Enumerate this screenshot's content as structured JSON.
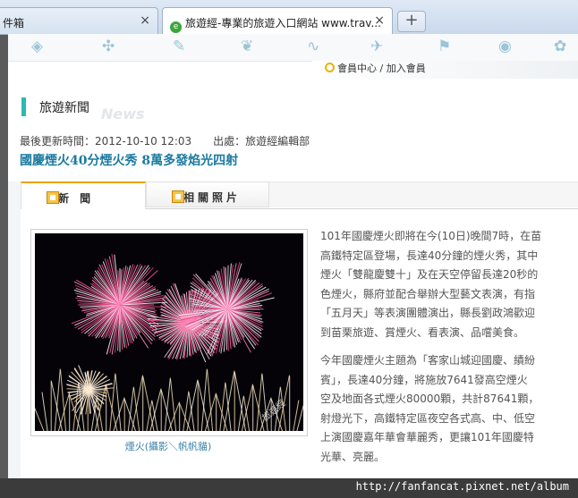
{
  "browser": {
    "tab1_title": "件箱",
    "tab2_title": "旅遊經-專業的旅遊入口網站 www.trav...",
    "close_glyph": "×",
    "newtab_glyph": "+"
  },
  "site": {
    "member_link": "會員中心 / 加入會員",
    "section_title": "旅遊新聞",
    "section_watermark": "News"
  },
  "article": {
    "meta_updated": "最後更新時間：2012-10-10 12:03",
    "meta_source": "出處：旅遊經編輯部",
    "headline": "國慶煙火40分煙火秀 8萬多發焰光四射",
    "tab_news": "新 聞",
    "tab_photos": "相關照片",
    "photo_caption": "煙火(攝影＼帆帆貓)",
    "photo_watermark": "旅遊經",
    "paragraph1_lines": [
      "101年國慶煙火即將在今(10日)晚間7時，在苗",
      "高鐵特定區登場，長達40分鐘的煙火秀，其中",
      "煙火「雙龍慶雙十」及在天空停留長達20秒的",
      "色煙火，縣府並配合舉辦大型藝文表演，有指",
      "「五月天」等表演團體演出，縣長劉政鴻歡迎",
      "到苗栗旅遊、賞煙火、看表演、品嚐美食。"
    ],
    "paragraph2_lines": [
      "今年國慶煙火主題為「客家山城迎國慶、績紛",
      "賓」，長達40分鐘，將施放7641發高空煙火",
      "空及地面各式煙火80000顆，共計87641顆，",
      "射燈光下，高鐵特定區夜空各式高、中、低空",
      "上演國慶嘉年華會華麗秀，更讓101年國慶特",
      "光華、亮麗。"
    ]
  },
  "statusbar": {
    "url": "http://fanfancat.pixnet.net/album"
  }
}
